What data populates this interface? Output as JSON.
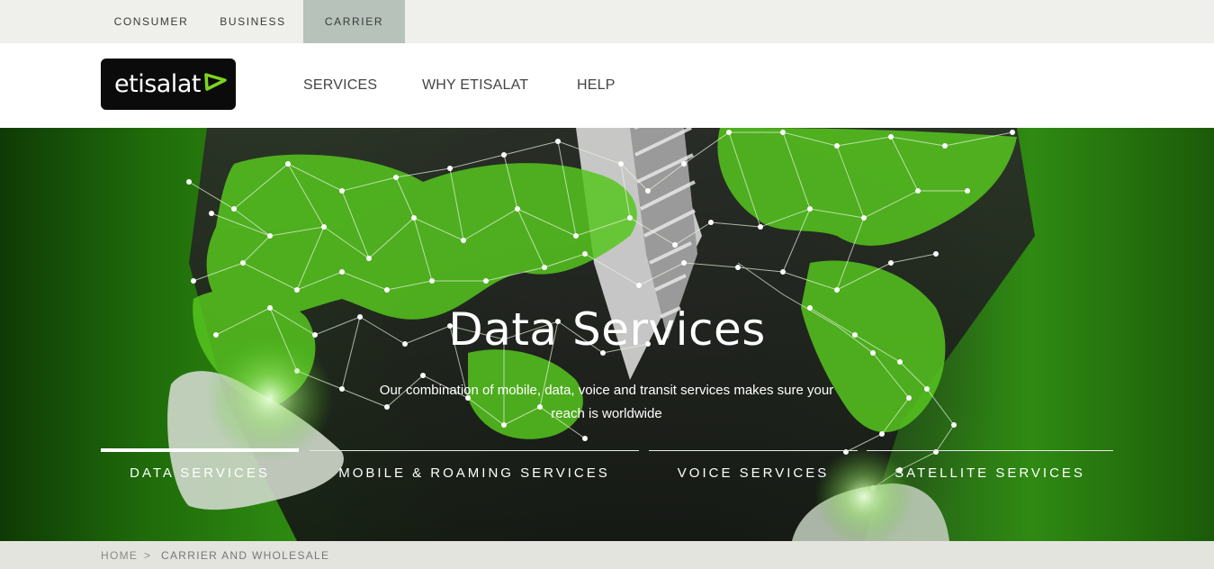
{
  "segments": [
    "CONSUMER",
    "BUSINESS",
    "CARRIER"
  ],
  "logo": {
    "text": "etisalat"
  },
  "nav": [
    "SERVICES",
    "WHY ETISALAT",
    "HELP"
  ],
  "hero": {
    "title": "Data Services",
    "subtitle": "Our combination of mobile, data, voice and transit services makes sure your reach is worldwide"
  },
  "tabs": [
    "DATA SERVICES",
    "MOBILE & ROAMING SERVICES",
    "VOICE SERVICES",
    "SATELLITE SERVICES"
  ],
  "active_tab": "DATA SERVICES",
  "breadcrumb": {
    "home": "HOME",
    "separator": ">",
    "current": "CARRIER AND WHOLESALE"
  },
  "colors": {
    "brand_green": "#7ed321",
    "carrier_active": "#b6c2ba",
    "logo_bg": "#0b0b0b"
  }
}
